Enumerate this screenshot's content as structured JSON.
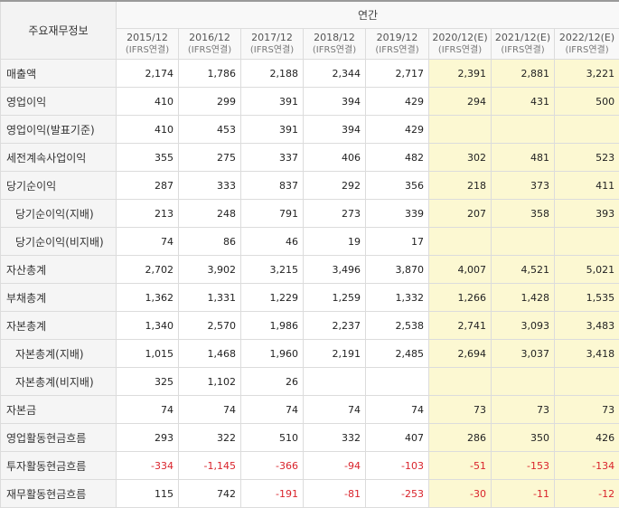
{
  "header": {
    "corner_label": "주요재무정보",
    "group_label": "연간",
    "periods": [
      {
        "year": "2015/12",
        "basis": "(IFRS연결)",
        "estimate": false
      },
      {
        "year": "2016/12",
        "basis": "(IFRS연결)",
        "estimate": false
      },
      {
        "year": "2017/12",
        "basis": "(IFRS연결)",
        "estimate": false
      },
      {
        "year": "2018/12",
        "basis": "(IFRS연결)",
        "estimate": false
      },
      {
        "year": "2019/12",
        "basis": "(IFRS연결)",
        "estimate": false
      },
      {
        "year": "2020/12(E)",
        "basis": "(IFRS연결)",
        "estimate": true
      },
      {
        "year": "2021/12(E)",
        "basis": "(IFRS연결)",
        "estimate": true
      },
      {
        "year": "2022/12(E)",
        "basis": "(IFRS연결)",
        "estimate": true
      }
    ]
  },
  "rows": [
    {
      "name": "revenue",
      "label": "매출액",
      "indent": false,
      "values": [
        "2,174",
        "1,786",
        "2,188",
        "2,344",
        "2,717",
        "2,391",
        "2,881",
        "3,221"
      ]
    },
    {
      "name": "operating-income",
      "label": "영업이익",
      "indent": false,
      "values": [
        "410",
        "299",
        "391",
        "394",
        "429",
        "294",
        "431",
        "500"
      ]
    },
    {
      "name": "operating-income-reported",
      "label": "영업이익(발표기준)",
      "indent": false,
      "values": [
        "410",
        "453",
        "391",
        "394",
        "429",
        "",
        "",
        ""
      ]
    },
    {
      "name": "pretax-income",
      "label": "세전계속사업이익",
      "indent": false,
      "values": [
        "355",
        "275",
        "337",
        "406",
        "482",
        "302",
        "481",
        "523"
      ]
    },
    {
      "name": "net-income",
      "label": "당기순이익",
      "indent": false,
      "values": [
        "287",
        "333",
        "837",
        "292",
        "356",
        "218",
        "373",
        "411"
      ]
    },
    {
      "name": "net-income-controlling",
      "label": "당기순이익(지배)",
      "indent": true,
      "values": [
        "213",
        "248",
        "791",
        "273",
        "339",
        "207",
        "358",
        "393"
      ]
    },
    {
      "name": "net-income-noncontrolling",
      "label": "당기순이익(비지배)",
      "indent": true,
      "values": [
        "74",
        "86",
        "46",
        "19",
        "17",
        "",
        "",
        ""
      ]
    },
    {
      "name": "total-assets",
      "label": "자산총계",
      "indent": false,
      "values": [
        "2,702",
        "3,902",
        "3,215",
        "3,496",
        "3,870",
        "4,007",
        "4,521",
        "5,021"
      ]
    },
    {
      "name": "total-liabilities",
      "label": "부채총계",
      "indent": false,
      "values": [
        "1,362",
        "1,331",
        "1,229",
        "1,259",
        "1,332",
        "1,266",
        "1,428",
        "1,535"
      ]
    },
    {
      "name": "total-equity",
      "label": "자본총계",
      "indent": false,
      "values": [
        "1,340",
        "2,570",
        "1,986",
        "2,237",
        "2,538",
        "2,741",
        "3,093",
        "3,483"
      ]
    },
    {
      "name": "total-equity-controlling",
      "label": "자본총계(지배)",
      "indent": true,
      "values": [
        "1,015",
        "1,468",
        "1,960",
        "2,191",
        "2,485",
        "2,694",
        "3,037",
        "3,418"
      ]
    },
    {
      "name": "total-equity-noncontrolling",
      "label": "자본총계(비지배)",
      "indent": true,
      "values": [
        "325",
        "1,102",
        "26",
        "",
        "",
        "",
        "",
        ""
      ]
    },
    {
      "name": "capital-stock",
      "label": "자본금",
      "indent": false,
      "values": [
        "74",
        "74",
        "74",
        "74",
        "74",
        "73",
        "73",
        "73"
      ]
    },
    {
      "name": "operating-cash-flow",
      "label": "영업활동현금흐름",
      "indent": false,
      "values": [
        "293",
        "322",
        "510",
        "332",
        "407",
        "286",
        "350",
        "426"
      ]
    },
    {
      "name": "investing-cash-flow",
      "label": "투자활동현금흐름",
      "indent": false,
      "values": [
        "-334",
        "-1,145",
        "-366",
        "-94",
        "-103",
        "-51",
        "-153",
        "-134"
      ]
    },
    {
      "name": "financing-cash-flow",
      "label": "재무활동현금흐름",
      "indent": false,
      "values": [
        "115",
        "742",
        "-191",
        "-81",
        "-253",
        "-30",
        "-11",
        "-12"
      ]
    }
  ]
}
